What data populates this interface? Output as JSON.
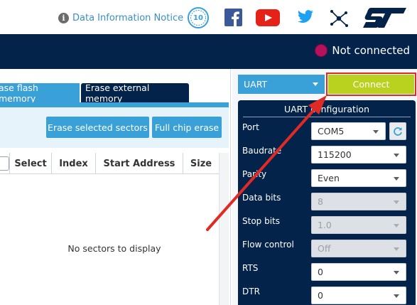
{
  "header": {
    "info_link": "Data Information Notice",
    "icons": [
      "info-icon",
      "10-years-badge-icon",
      "facebook-icon",
      "youtube-icon",
      "twitter-icon",
      "network-icon",
      "st-logo-icon"
    ],
    "logo_text": "ST"
  },
  "status": {
    "text": "Not connected",
    "color": "#b5125b"
  },
  "colors": {
    "navy": "#03234b",
    "accent": "#3aa0d8",
    "connect": "#b9d11f",
    "highlight": "#e02a25"
  },
  "erase": {
    "tabs": [
      "ase flash memory",
      "Erase external memory"
    ],
    "buttons": {
      "erase_selected": "Erase selected sectors",
      "full_chip": "Full chip erase"
    },
    "columns": [
      "Select",
      "Index",
      "Start Address",
      "Size"
    ],
    "empty_message": "No sectors to display"
  },
  "connection": {
    "interface": "UART",
    "connect_label": "Connect",
    "config_title": "UART configuration",
    "params": [
      {
        "label": "Port",
        "value": "COM5",
        "enabled": true
      },
      {
        "label": "Baudrate",
        "value": "115200",
        "enabled": true
      },
      {
        "label": "Parity",
        "value": "Even",
        "enabled": true
      },
      {
        "label": "Data bits",
        "value": "8",
        "enabled": false
      },
      {
        "label": "Stop bits",
        "value": "1.0",
        "enabled": false
      },
      {
        "label": "Flow control",
        "value": "Off",
        "enabled": false
      },
      {
        "label": "RTS",
        "value": "0",
        "enabled": true
      },
      {
        "label": "DTR",
        "value": "0",
        "enabled": true
      }
    ]
  }
}
